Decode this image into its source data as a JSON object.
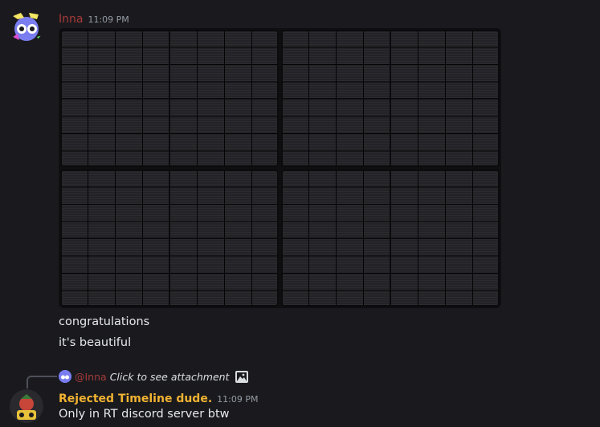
{
  "messages": [
    {
      "author": "Inna",
      "author_color": "#a83a3a",
      "time": "11:09 PM",
      "attachment": "image-grid",
      "lines": [
        "congratulations",
        "it's beautiful"
      ]
    },
    {
      "reply": {
        "mention": "@Inna",
        "hint": "Click to see attachment",
        "icon": "image-icon"
      },
      "author": "Rejected Timeline dude.",
      "author_color": "#f0b232",
      "time": "11:09 PM",
      "lines": [
        "Only in RT discord server btw"
      ]
    }
  ]
}
